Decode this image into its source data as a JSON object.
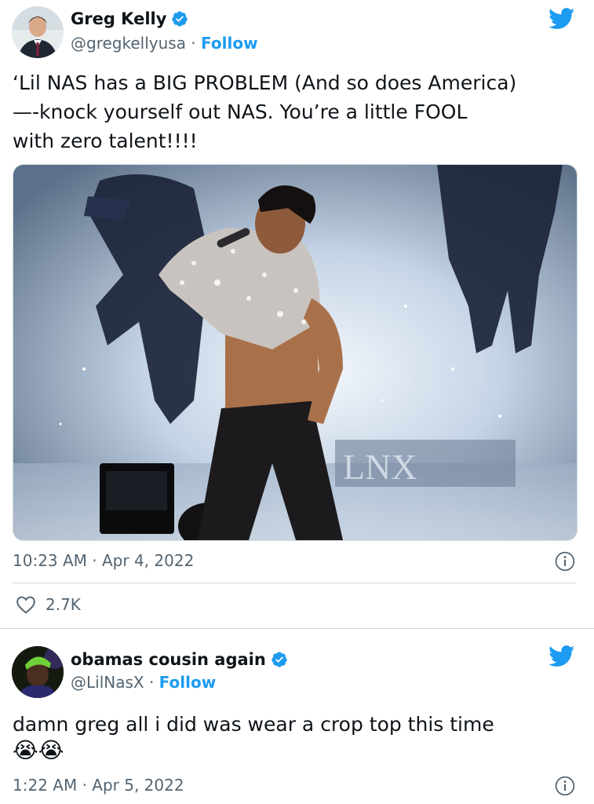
{
  "tweet1": {
    "name": "Greg Kelly",
    "handle": "@gregkellyusa",
    "separator": " · ",
    "follow": "Follow",
    "text": "‘Lil NAS has a BIG PROBLEM (And so does America)\n—-knock yourself out NAS.  You’re a little FOOL\nwith zero talent!!!!",
    "time": "10:23 AM · Apr 4, 2022",
    "likes": "2.7K",
    "media_text": "LNX"
  },
  "tweet2": {
    "name": "obamas cousin again",
    "handle": "@LilNasX",
    "separator": " · ",
    "follow": "Follow",
    "text": "damn greg all i did was wear a crop top this time",
    "emojis": "😭😭",
    "time": "1:22 AM · Apr 5, 2022"
  },
  "colors": {
    "accent": "#1d9bf0",
    "text": "#0f1419",
    "muted": "#536471",
    "border": "#cfd9de"
  },
  "icons": [
    "verified-badge-icon",
    "twitter-bird-icon",
    "info-icon",
    "heart-icon"
  ]
}
